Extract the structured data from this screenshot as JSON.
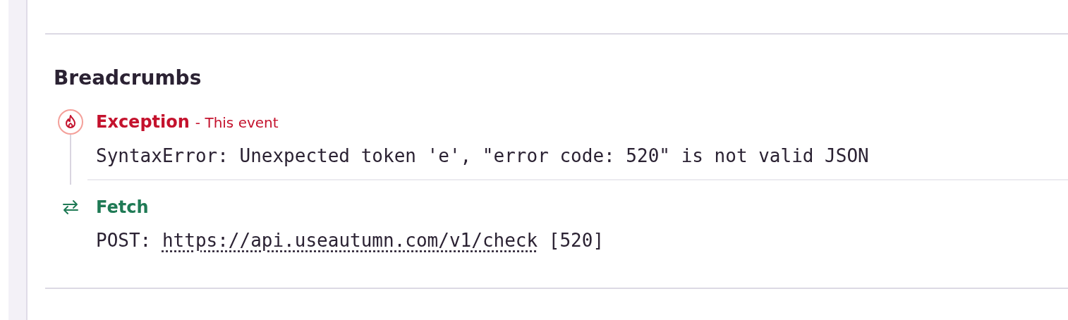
{
  "section": {
    "title": "Breadcrumbs"
  },
  "breadcrumbs": [
    {
      "kind": "exception",
      "title": "Exception",
      "subtitle": "- This event",
      "message": "SyntaxError: Unexpected token 'e', \"error code: 520\" is not valid JSON"
    },
    {
      "kind": "fetch",
      "title": "Fetch",
      "method": "POST:",
      "url": "https://api.useautumn.com/v1/check",
      "status": "[520]"
    }
  ]
}
